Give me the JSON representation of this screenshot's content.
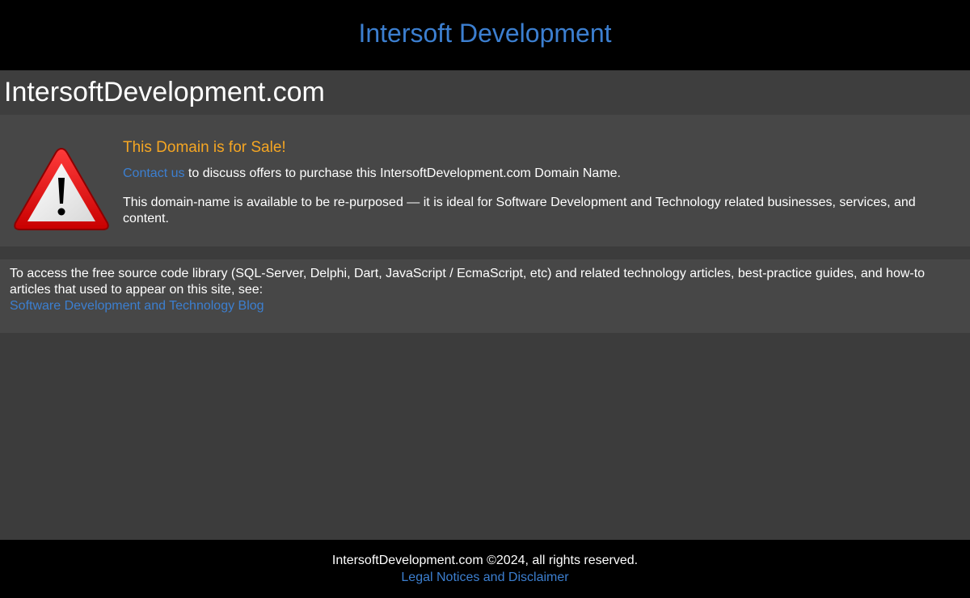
{
  "header": {
    "title": "Intersoft Development"
  },
  "domain_bar": {
    "domain_name": "IntersoftDevelopment.com"
  },
  "sale_panel": {
    "icon": "warning-triangle-icon",
    "heading": "This Domain is for Sale!",
    "contact_link": "Contact us",
    "contact_text": " to discuss offers to purchase this IntersoftDevelopment.com Domain Name.",
    "description": "This domain-name is available to be re-purposed — it is ideal for Software Development and Technology related businesses, services, and content."
  },
  "library_panel": {
    "text": "To access the free source code library (SQL-Server, Delphi, Dart, JavaScript / EcmaScript, etc) and related technology articles, best-practice guides, and how-to articles that used to appear on this site, see:",
    "link": "Software Development and Technology Blog"
  },
  "footer": {
    "copyright": "IntersoftDevelopment.com ©2024, all rights reserved.",
    "legal_link": "Legal Notices and Disclaimer"
  },
  "colors": {
    "link": "#3c7fd0",
    "heading_accent": "#f5a623",
    "background": "#3c3c3c",
    "panel": "#474747",
    "header_footer": "#000000"
  }
}
